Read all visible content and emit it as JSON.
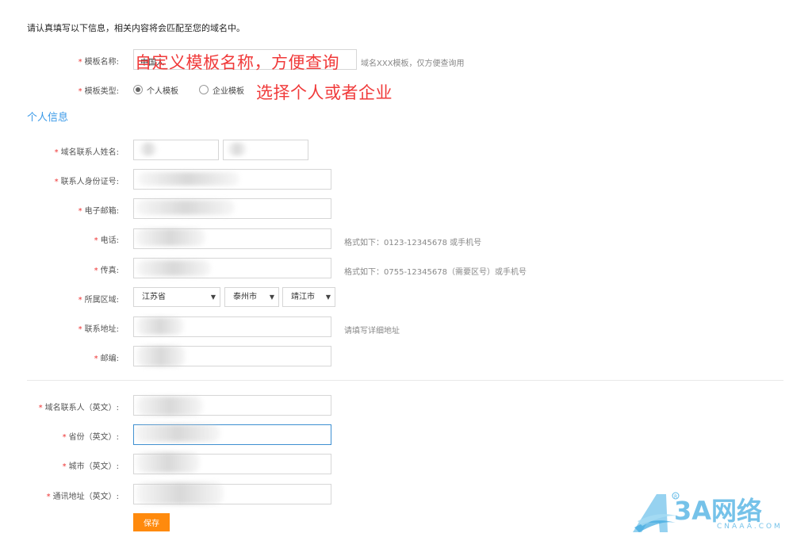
{
  "intro_text": "请认真填写以下信息，相关内容将会匹配至您的域名中。",
  "annotations": {
    "template_name": "自定义模板名称，方便查询",
    "template_type": "选择个人或者企业"
  },
  "template": {
    "name_label": "模板名称:",
    "name_value": "中国人",
    "name_hint": "域名XXX模板，仅方便查询用",
    "type_label": "模板类型:",
    "type_options": [
      "个人模板",
      "企业模板"
    ],
    "type_selected": "个人模板"
  },
  "section_title": "个人信息",
  "personal": {
    "contact_name_label": "域名联系人姓名:",
    "id_label": "联系人身份证号:",
    "email_label": "电子邮箱:",
    "phone_label": "电话:",
    "phone_hint": "格式如下：0123-12345678 或手机号",
    "fax_label": "传真:",
    "fax_hint": "格式如下：0755-12345678（需要区号）或手机号",
    "region_label": "所属区域:",
    "province": "江苏省",
    "city": "泰州市",
    "district": "靖江市",
    "address_label": "联系地址:",
    "address_hint": "请填写详细地址",
    "zip_label": "邮编:"
  },
  "english": {
    "contact_label": "域名联系人（英文）:",
    "province_label": "省份（英文）:",
    "city_label": "城市（英文）:",
    "address_label": "通讯地址（英文）:"
  },
  "save_label": "保存",
  "logo": {
    "text": "3A网络",
    "sub": "CNAAA.COM",
    "color": "#5eb8e6"
  }
}
